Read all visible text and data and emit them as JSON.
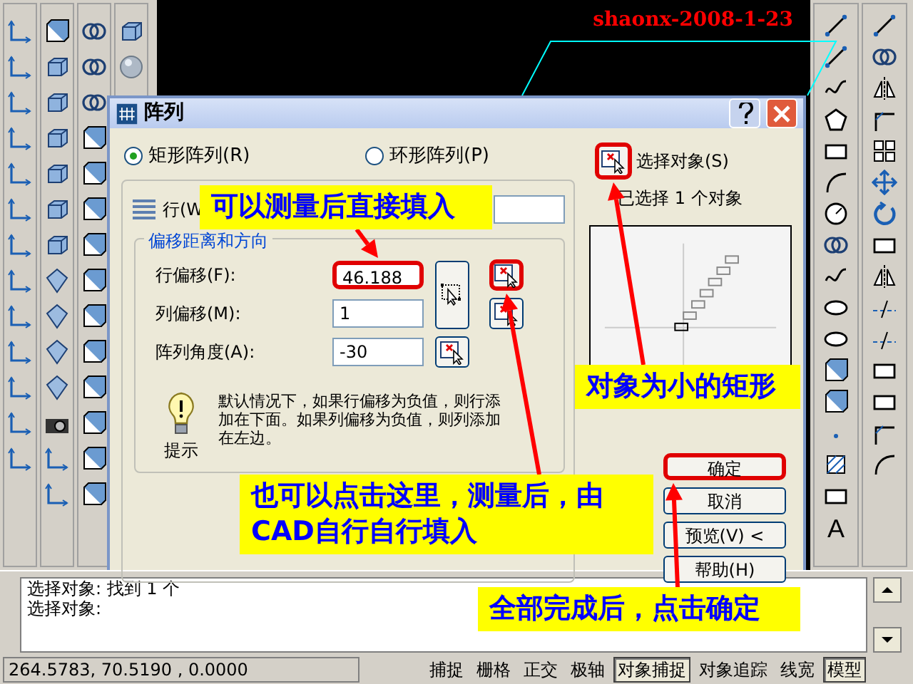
{
  "signature": "shaonx-2008-1-23",
  "dialog": {
    "title": "阵列",
    "array_types": [
      {
        "label": "矩形阵列(R)",
        "selected": true
      },
      {
        "label": "环形阵列(P)",
        "selected": false
      }
    ],
    "rows_label": "行(W",
    "offset_group": {
      "title": "偏移距离和方向",
      "fields": [
        {
          "label": "行偏移(F):",
          "value": "46.188",
          "highlighted": true,
          "pick_highlighted": true
        },
        {
          "label": "列偏移(M):",
          "value": "1",
          "highlighted": false,
          "pick_highlighted": false
        },
        {
          "label": "阵列角度(A):",
          "value": "-30",
          "highlighted": false,
          "pick_highlighted": false
        }
      ]
    },
    "hint_label": "提示",
    "hint_text": "默认情况下，如果行偏移为负值，则行添加在下面。如果列偏移为负值，则列添加在左边。",
    "select_label": "选择对象(S)",
    "select_highlighted": true,
    "selected_count": "已选择 1 个对象",
    "buttons": [
      {
        "label": "确定",
        "highlighted": true
      },
      {
        "label": "取消",
        "highlighted": false
      },
      {
        "label": "预览(V) <",
        "highlighted": false
      },
      {
        "label": "帮助(H)",
        "highlighted": false
      }
    ]
  },
  "callouts": [
    {
      "lines": [
        "可以测量后直接填入"
      ]
    },
    {
      "lines": [
        "也可以点击这里，测量后，由",
        "CAD自行自行填入"
      ]
    },
    {
      "lines": [
        "对象为小的矩形"
      ]
    },
    {
      "lines": [
        "全部完成后，点击确定"
      ]
    }
  ],
  "command_lines": [
    "选择对象: 找到 1 个",
    "选择对象:"
  ],
  "coordinates": "264.5783, 70.5190 , 0.0000",
  "status_buttons": [
    {
      "label": "捕捉",
      "pressed": false
    },
    {
      "label": "栅格",
      "pressed": false
    },
    {
      "label": "正交",
      "pressed": false
    },
    {
      "label": "极轴",
      "pressed": false
    },
    {
      "label": "对象捕捉",
      "pressed": true
    },
    {
      "label": "对象追踪",
      "pressed": false
    },
    {
      "label": "线宽",
      "pressed": false
    },
    {
      "label": "模型",
      "pressed": true
    }
  ],
  "draw_toolbar_letter": "A"
}
